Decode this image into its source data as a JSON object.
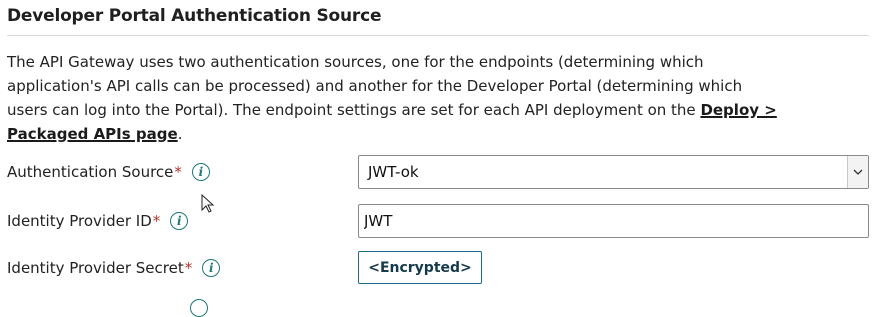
{
  "section": {
    "title": "Developer Portal Authentication Source",
    "description_text": "The API Gateway uses two authentication sources, one for the endpoints (determining which application's API calls can be processed) and another for the Developer Portal (determining which users can log into the Portal). The endpoint settings are set for each API deployment on the ",
    "description_link": "Deploy > Packaged APIs page",
    "description_end": "."
  },
  "fields": {
    "auth_source": {
      "label": "Authentication Source",
      "required_mark": "*",
      "value": "JWT-ok"
    },
    "idp_id": {
      "label": "Identity Provider ID",
      "required_mark": "*",
      "value": "JWT"
    },
    "idp_secret": {
      "label": "Identity Provider Secret",
      "required_mark": "*",
      "button_label": "<Encrypted>"
    }
  },
  "icons": {
    "info": "info-icon",
    "info_glyph": "i",
    "dropdown": "chevron-down-icon"
  },
  "colors": {
    "accent": "#1d7a74",
    "required": "#b8332e",
    "button_border": "#1d6a8a"
  }
}
